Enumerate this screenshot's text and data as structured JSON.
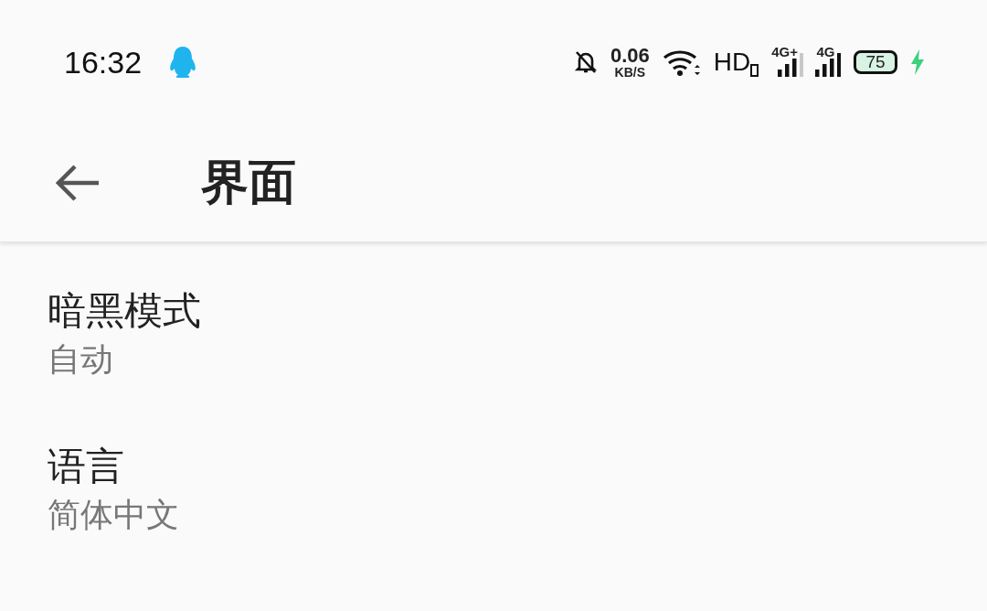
{
  "status_bar": {
    "time": "16:32",
    "net_speed": {
      "value": "0.06",
      "unit": "KB/S"
    },
    "hd": "HD",
    "signals": [
      {
        "label": "4G+",
        "full": false
      },
      {
        "label": "4G",
        "full": true
      }
    ],
    "battery": {
      "text": "75",
      "charging": true
    }
  },
  "header": {
    "title": "界面"
  },
  "settings": [
    {
      "title": "暗黑模式",
      "value": "自动"
    },
    {
      "title": "语言",
      "value": "简体中文"
    }
  ]
}
